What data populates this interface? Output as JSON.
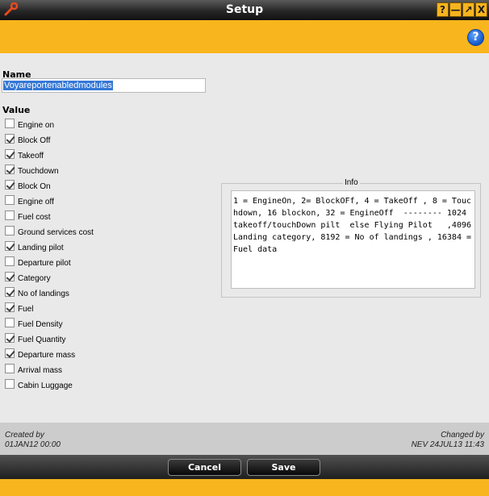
{
  "window": {
    "title": "Setup",
    "controls": {
      "help": "?",
      "minimize": "—",
      "maximize": "↗",
      "close": "X"
    }
  },
  "help_label": "?",
  "form": {
    "name_label": "Name",
    "name_value": "Voyareportenabledmodules",
    "value_label": "Value",
    "options": [
      {
        "label": "Engine on",
        "checked": false
      },
      {
        "label": "Block Off",
        "checked": true
      },
      {
        "label": "Takeoff",
        "checked": true
      },
      {
        "label": "Touchdown",
        "checked": true
      },
      {
        "label": "Block On",
        "checked": true
      },
      {
        "label": "Engine off",
        "checked": false
      },
      {
        "label": "Fuel cost",
        "checked": false
      },
      {
        "label": "Ground services cost",
        "checked": false
      },
      {
        "label": "Landing pilot",
        "checked": true
      },
      {
        "label": "Departure pilot",
        "checked": false
      },
      {
        "label": "Category",
        "checked": true
      },
      {
        "label": "No of landings",
        "checked": true
      },
      {
        "label": "Fuel",
        "checked": true
      },
      {
        "label": "Fuel Density",
        "checked": false
      },
      {
        "label": "Fuel Quantity",
        "checked": true
      },
      {
        "label": "Departure mass",
        "checked": true
      },
      {
        "label": "Arrival mass",
        "checked": false
      },
      {
        "label": "Cabin Luggage",
        "checked": false
      }
    ]
  },
  "info": {
    "title": "Info",
    "text": "1 = EngineOn, 2= BlockOFf, 4 = TakeOff , 8 = Touchdown, 16 blockon, 32 = EngineOff  -------- 1024 takeoff/touchDown pilt  else Flying Pilot   ,4096 Landing category, 8192 = No of landings , 16384 = Fuel data"
  },
  "footer": {
    "created_label": "Created by",
    "created_value": "01JAN12 00:00",
    "changed_label": "Changed by",
    "changed_value": "NEV 24JUL13 11:43"
  },
  "buttons": {
    "cancel": "Cancel",
    "save": "Save"
  },
  "colors": {
    "accent": "#f8b51d",
    "titlebar": "#262626",
    "selection": "#3577d6"
  }
}
